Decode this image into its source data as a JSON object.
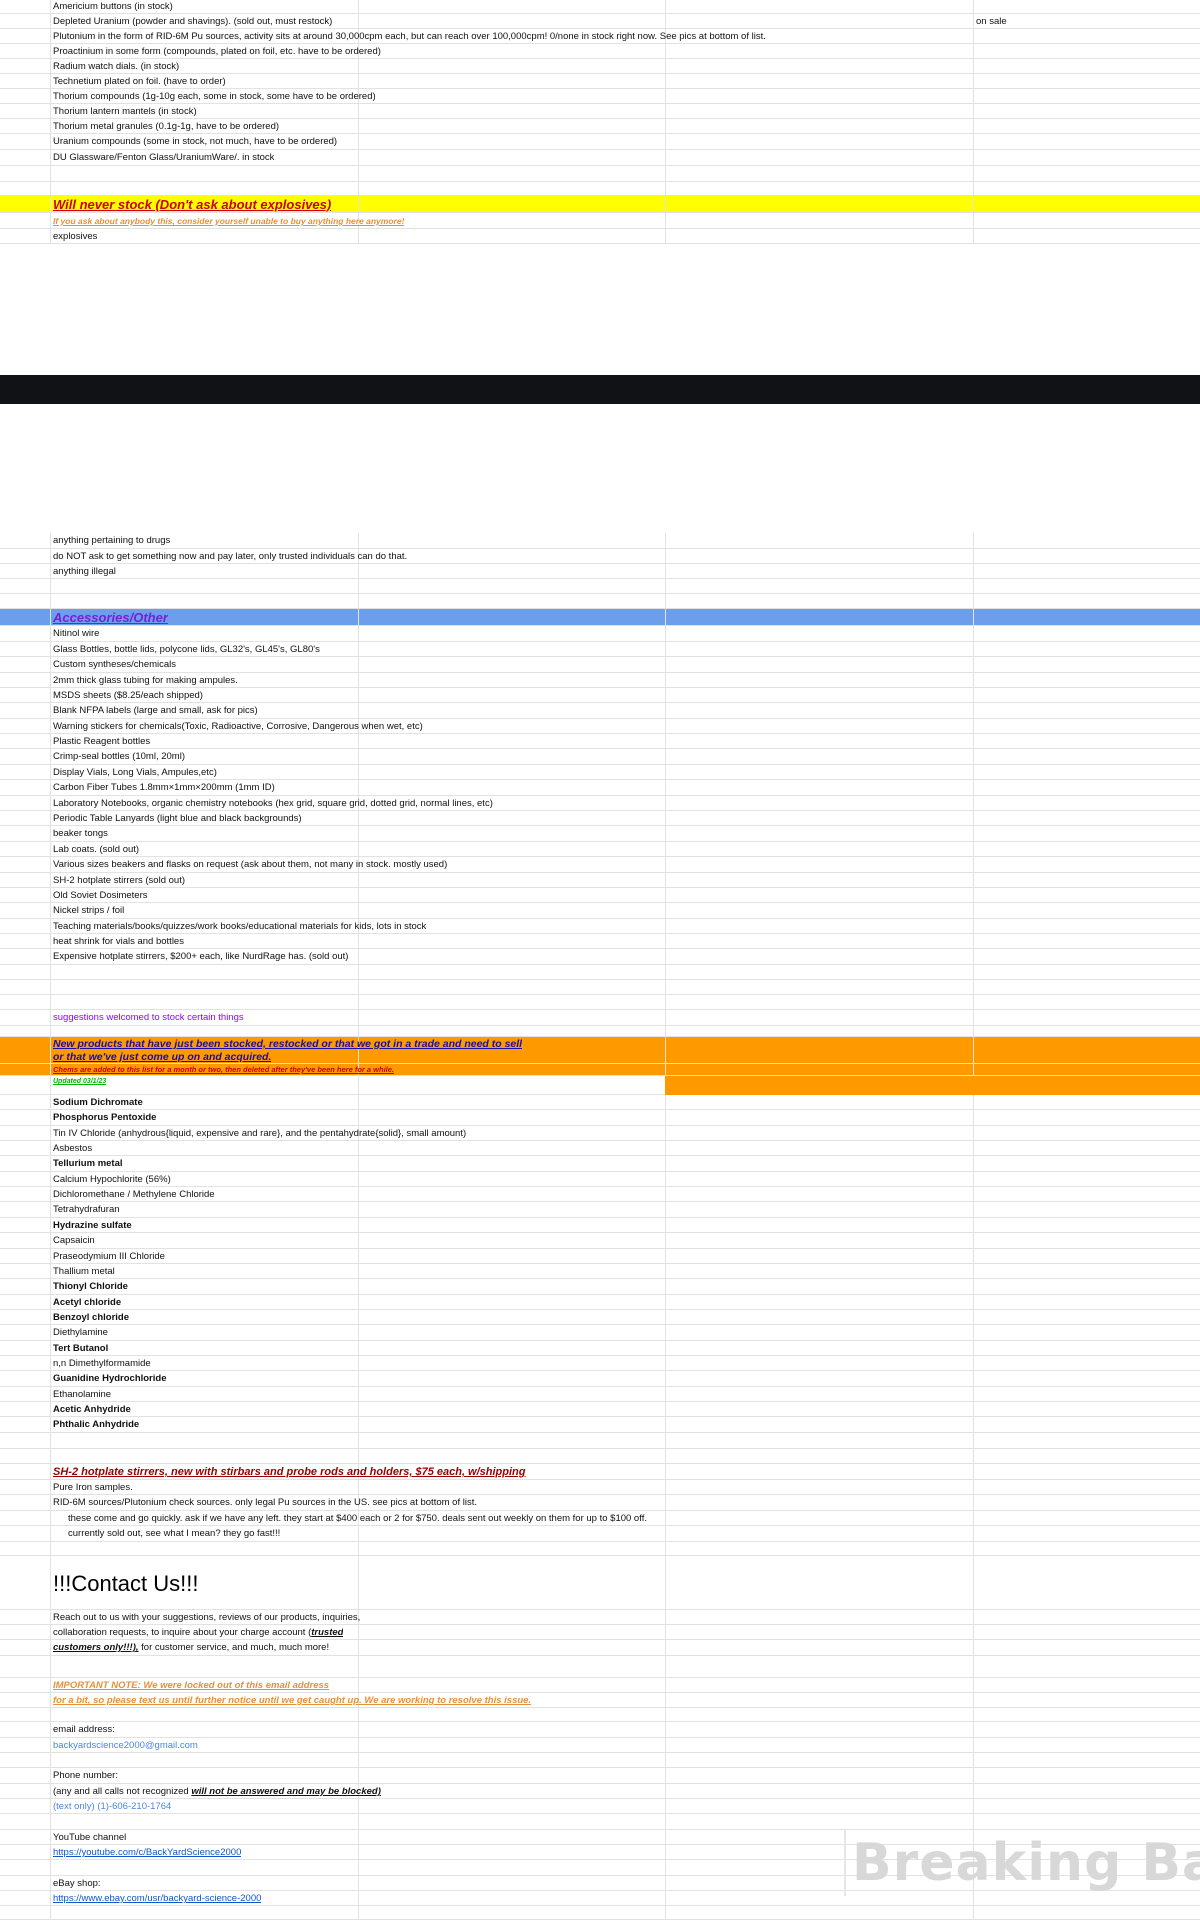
{
  "section_radioactive": {
    "items": [
      "Americium buttons     (in stock)",
      "Depleted Uranium (powder and shavings). (sold out, must restock)",
      "Plutonium in the form of RID-6M Pu sources, activity sits at around 30,000cpm each, but can reach over 100,000cpm!   0/none in stock right now.   See pics at bottom of list.",
      "Proactinium in some form (compounds, plated on foil, etc. have to be ordered)",
      "Radium watch dials.        (in stock)",
      "Technetium plated on foil.     (have to order)",
      "Thorium compounds    (1g-10g each, some in stock, some have to be ordered)",
      "Thorium lantern mantels   (in stock)",
      "Thorium metal granules (0.1g-1g, have to be ordered)",
      "Uranium compounds    (some in stock, not much, have to be ordered)",
      "DU Glassware/Fenton Glass/UraniumWare/.  in stock"
    ],
    "on_sale_note": "on sale"
  },
  "never_stock": {
    "title": "Will never stock (Don't ask about explosives)",
    "subtitle": "If you ask about anybody this, consider yourself unable to buy anything here anymore!",
    "items_top": [
      "explosives"
    ],
    "items_bottom": [
      "anything pertaining to drugs",
      "do NOT ask to get something now and pay later, only trusted individuals can do that.",
      "anything illegal"
    ]
  },
  "accessories": {
    "title": "Accessories/Other",
    "items": [
      "Nitinol wire",
      "Glass Bottles, bottle lids, polycone lids, GL32's, GL45's, GL80's",
      "Custom syntheses/chemicals",
      "2mm thick glass tubing for making ampules.",
      "MSDS sheets ($8.25/each shipped)",
      "Blank NFPA labels (large and small, ask for pics)",
      "Warning stickers for chemicals(Toxic, Radioactive, Corrosive, Dangerous when wet, etc)",
      "Plastic Reagent bottles",
      "Crimp-seal bottles (10ml, 20ml)",
      "Display Vials, Long Vials, Ampules,etc)",
      "Carbon Fiber Tubes 1.8mm×1mm×200mm (1mm ID)",
      "Laboratory Notebooks, organic chemistry notebooks (hex grid, square grid, dotted grid, normal lines, etc)",
      "Periodic Table Lanyards (light blue and black backgrounds)",
      "beaker tongs",
      "Lab coats. (sold out)",
      "Various sizes beakers and flasks on request (ask about them, not many in stock.  mostly used)",
      "SH-2 hotplate stirrers (sold out)",
      "Old Soviet Dosimeters",
      "Nickel  strips / foil",
      "Teaching materials/books/quizzes/work books/educational materials for kids, lots in stock",
      "heat shrink for vials and bottles",
      "Expensive hotplate stirrers, $200+ each, like NurdRage has.   (sold out)"
    ],
    "suggestions": "suggestions welcomed to stock certain things"
  },
  "new_products": {
    "title_line1": "New products that have just been stocked, restocked or that we got in a trade and need to sell",
    "title_line2": "or that we've just come up on and acquired.",
    "subtitle": "Chems are added to this list for a month or two, then deleted after they've been here for a while.",
    "updated": "Updated 03/1/23",
    "items": [
      {
        "text": "Sodium Dichromate",
        "bold": true
      },
      {
        "text": "Phosphorus Pentoxide",
        "bold": true
      },
      {
        "text": "Tin IV Chloride (anhydrous{liquid, expensive and rare}, and the pentahydrate{solid}, small amount)",
        "bold": false
      },
      {
        "text": "Asbestos",
        "bold": false
      },
      {
        "text": "Tellurium metal",
        "bold": true
      },
      {
        "text": "Calcium Hypochlorite (56%)",
        "bold": false
      },
      {
        "text": "Dichloromethane / Methylene Chloride",
        "bold": false
      },
      {
        "text": "Tetrahydrafuran",
        "bold": false
      },
      {
        "text": "Hydrazine sulfate",
        "bold": true
      },
      {
        "text": "Capsaicin",
        "bold": false
      },
      {
        "text": "Praseodymium III Chloride",
        "bold": false
      },
      {
        "text": "Thallium metal",
        "bold": false
      },
      {
        "text": "Thionyl Chloride",
        "bold": true
      },
      {
        "text": "Acetyl chloride",
        "bold": true
      },
      {
        "text": "Benzoyl chloride",
        "bold": true
      },
      {
        "text": "Diethylamine",
        "bold": false
      },
      {
        "text": "Tert Butanol",
        "bold": true
      },
      {
        "text": "n,n Dimethylformamide",
        "bold": false
      },
      {
        "text": "Guanidine Hydrochloride",
        "bold": true
      },
      {
        "text": "Ethanolamine",
        "bold": false
      },
      {
        "text": "Acetic Anhydride",
        "bold": true
      },
      {
        "text": "Phthalic Anhydride",
        "bold": true
      }
    ]
  },
  "sh2": {
    "title": "SH-2 hotplate stirrers, new with stirbars and probe rods and holders, $75 each, w/shipping",
    "items": [
      "Pure Iron samples.",
      "RID-6M sources/Plutonium check sources.  only legal Pu sources in the US.  see pics at bottom of list.",
      "these come and go quickly.  ask if we have any left.  they start at $400 each or 2 for $750.   deals sent out weekly on them for up to $100 off.",
      "currently sold out, see what I mean?  they go fast!!!"
    ]
  },
  "contact": {
    "title": "!!!Contact Us!!!",
    "intro_line1": "Reach out to us with your suggestions, reviews of our products, inquiries,",
    "intro_line2_prefix": "collaboration requests, to inquire about your charge account (",
    "intro_line2_emph": "trusted",
    "intro_line3_emph": "customers only!!!),",
    "intro_line3_suffix": " for customer service, and much, much more!",
    "note_line1": "IMPORTANT NOTE:  We were locked out of this email address",
    "note_line2": "for a bit, so please text us until further notice until we get caught up.  We are working to resolve this issue.",
    "email_label": "email address:",
    "email": "backyardscience2000@gmail.com",
    "phone_label": "Phone number:",
    "phone_note_prefix": "(any and all calls not recognized ",
    "phone_note_emph": "will not be answered and may be blocked)",
    "phone": "(text only) (1)-606-210-1764",
    "youtube_label": "YouTube channel",
    "youtube_url": "https://youtube.com/c/BackYardScience2000",
    "ebay_label": "eBay shop:",
    "ebay_url": "https://www.ebay.com/usr/backyard-science-2000"
  },
  "watermark": "Breaking Bad"
}
